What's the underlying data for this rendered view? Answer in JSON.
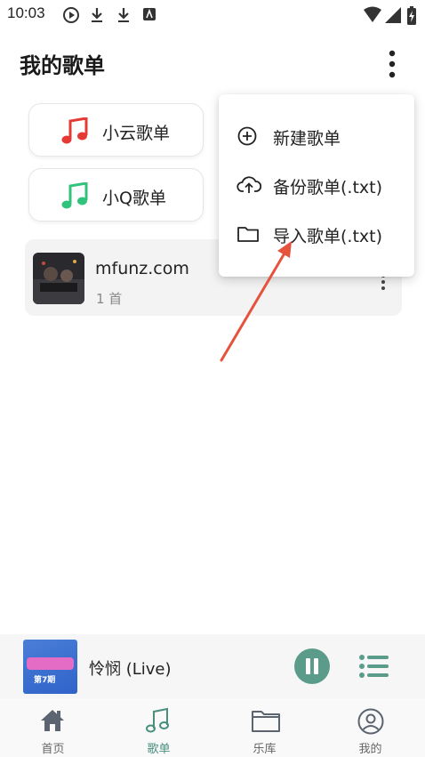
{
  "status_bar": {
    "time": "10:03"
  },
  "header": {
    "title": "我的歌单"
  },
  "sources": [
    {
      "label": "小云歌单",
      "color": "#e53935"
    },
    {
      "label": "小Q歌单",
      "color": "#31c27c"
    }
  ],
  "playlist": {
    "name": "mfunz.com",
    "count": "1 首"
  },
  "menu": {
    "items": [
      {
        "label": "新建歌单",
        "icon": "add-circle-icon"
      },
      {
        "label": "备份歌单(.txt)",
        "icon": "cloud-upload-icon"
      },
      {
        "label": "导入歌单(.txt)",
        "icon": "folder-icon"
      }
    ]
  },
  "player": {
    "title": "怜悯 (Live)",
    "cover_text": "第7期"
  },
  "nav": {
    "items": [
      {
        "label": "首页",
        "icon": "home-icon"
      },
      {
        "label": "歌单",
        "icon": "music-note-icon",
        "active": true
      },
      {
        "label": "乐库",
        "icon": "folder-icon"
      },
      {
        "label": "我的",
        "icon": "profile-icon"
      }
    ]
  },
  "colors": {
    "accent": "#5a9b8a",
    "annotation_arrow": "#e5533d"
  }
}
